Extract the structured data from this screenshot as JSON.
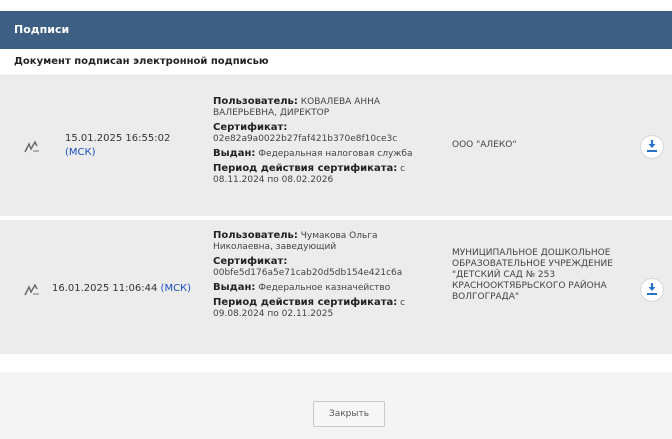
{
  "dialog": {
    "title": "Подписи",
    "subtitle": "Документ подписан электронной подписью",
    "close_label": "Закрыть"
  },
  "signatures": [
    {
      "date": "15.01.2025 16:55:02",
      "tz": "(МСК)",
      "user_label": "Пользователь:",
      "user_value": "КОВАЛЕВА АННА ВАЛЕРЬЕВНА, ДИРЕКТОР",
      "cert_label": "Сертификат:",
      "cert_value": "02e82a9a0022b27faf421b370e8f10ce3c",
      "issued_label": "Выдан:",
      "issued_value": "Федеральная налоговая служба",
      "period_label": "Период действия сертификата:",
      "period_value": "с 08.11.2024 по 08.02.2026",
      "org": "ООО \"АЛЕКО\""
    },
    {
      "date": "16.01.2025 11:06:44",
      "tz": "(МСК)",
      "user_label": "Пользователь:",
      "user_value": "Чумакова Ольга Николаевна, заведующий",
      "cert_label": "Сертификат:",
      "cert_value": "00bfe5d176a5e71cab20d5db154e421c6a",
      "issued_label": "Выдан:",
      "issued_value": "Федеральное казначейство",
      "period_label": "Период действия сертификата:",
      "period_value": "с 09.08.2024 по 02.11.2025",
      "org": "МУНИЦИПАЛЬНОЕ ДОШКОЛЬНОЕ ОБРАЗОВАТЕЛЬНОЕ УЧРЕЖДЕНИЕ \"ДЕТСКИЙ САД № 253 КРАСНООКТЯБРЬСКОГО РАЙОНА ВОЛГОГРАДА\""
    }
  ],
  "icons": {
    "signature": "signature-icon",
    "download": "download-icon"
  },
  "colors": {
    "header_bg": "#3d5f84",
    "tz_link": "#1a4fc4",
    "download_icon": "#2a72c9"
  }
}
